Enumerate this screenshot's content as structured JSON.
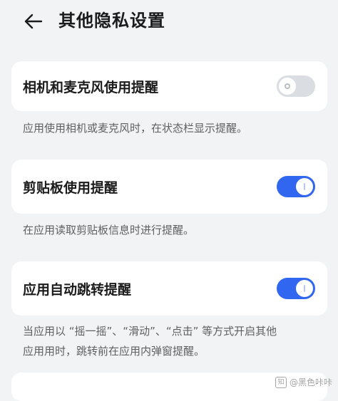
{
  "header": {
    "title": "其他隐私设置",
    "back_icon": "arrow-left-icon"
  },
  "settings": [
    {
      "label": "相机和麦克风使用提醒",
      "enabled": false,
      "description": "应用使用相机或麦克风时，在状态栏显示提醒。"
    },
    {
      "label": "剪贴板使用提醒",
      "enabled": true,
      "description": "在应用读取剪贴板信息时进行提醒。"
    },
    {
      "label": "应用自动跳转提醒",
      "enabled": true,
      "description_line1": "当应用以 “摇一摇”、“滑动”、“点击” 等方式开启其他",
      "description_line2": "应用用时，跳转前在应用内弹窗提醒。"
    }
  ],
  "watermark": {
    "text": "@黑色咔咔"
  },
  "colors": {
    "background": "#f1f3f5",
    "card": "#ffffff",
    "toggle_on": "#3166f1",
    "toggle_off": "#dadde1"
  }
}
